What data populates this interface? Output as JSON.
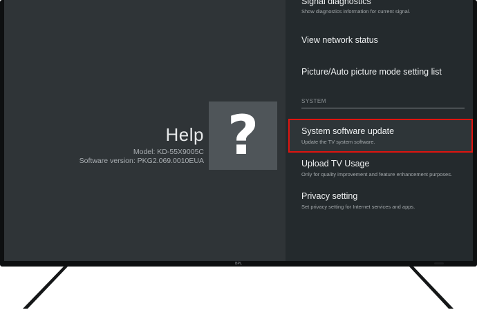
{
  "help_panel": {
    "title": "Help",
    "model": "Model: KD-55X9005C",
    "software_version": "Software version: PKG2.069.0010EUA",
    "icon": "question-mark-icon",
    "icon_glyph": "?"
  },
  "menu": {
    "items_top": [
      {
        "title": "Signal diagnostics",
        "subtitle": "Show diagnostics information for current signal."
      },
      {
        "title": "View network status"
      },
      {
        "title": "Picture/Auto picture mode setting list"
      }
    ],
    "section_header": "SYSTEM",
    "items_system": [
      {
        "title": "System software update",
        "subtitle": "Update the TV system software.",
        "selected": true
      },
      {
        "title": "Upload TV Usage",
        "subtitle": "Only for quality improvement and feature enhancement purposes."
      },
      {
        "title": "Privacy setting",
        "subtitle": "Set privacy setting for Internet services and apps."
      }
    ]
  },
  "tv": {
    "brand_label": "BPL"
  },
  "colors": {
    "highlight": "#e0140f",
    "left_pane_bg": "#2f3437",
    "right_pane_bg": "#242a2d",
    "icon_tile_bg": "#4f5559"
  }
}
